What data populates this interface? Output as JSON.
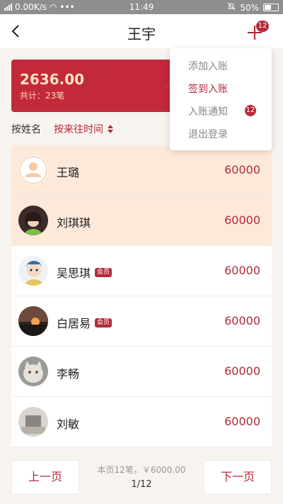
{
  "status_bar": {
    "network_speed": "0.00K/s",
    "time": "11:49",
    "battery": "50%"
  },
  "header": {
    "title": "王宇",
    "badge_count": "12"
  },
  "summary": {
    "amount": "2636.00",
    "count": "共计：23笔"
  },
  "sort": {
    "by_name": "按姓名",
    "by_time": "按来往时间"
  },
  "dropdown": {
    "items": [
      {
        "label": "添加入账"
      },
      {
        "label": "签到入账"
      },
      {
        "label": "入账通知",
        "badge": "12"
      },
      {
        "label": "退出登录"
      }
    ]
  },
  "list": {
    "rows": [
      {
        "name": "王璐",
        "amount": "60000",
        "vip": ""
      },
      {
        "name": "刘琪琪",
        "amount": "60000",
        "vip": ""
      },
      {
        "name": "吴思琪",
        "amount": "60000",
        "vip": "会员"
      },
      {
        "name": "白居易",
        "amount": "60000",
        "vip": "会员"
      },
      {
        "name": "李畅",
        "amount": "60000",
        "vip": ""
      },
      {
        "name": "刘敏",
        "amount": "60000",
        "vip": ""
      }
    ]
  },
  "footer": {
    "prev_label": "上一页",
    "next_label": "下一页",
    "page_summary": "本页12笔，￥6000.00",
    "page_number": "1/12"
  },
  "colors": {
    "accent": "#b32a3a",
    "card": "#c22a3b",
    "highlight_row": "#fde9d9"
  }
}
